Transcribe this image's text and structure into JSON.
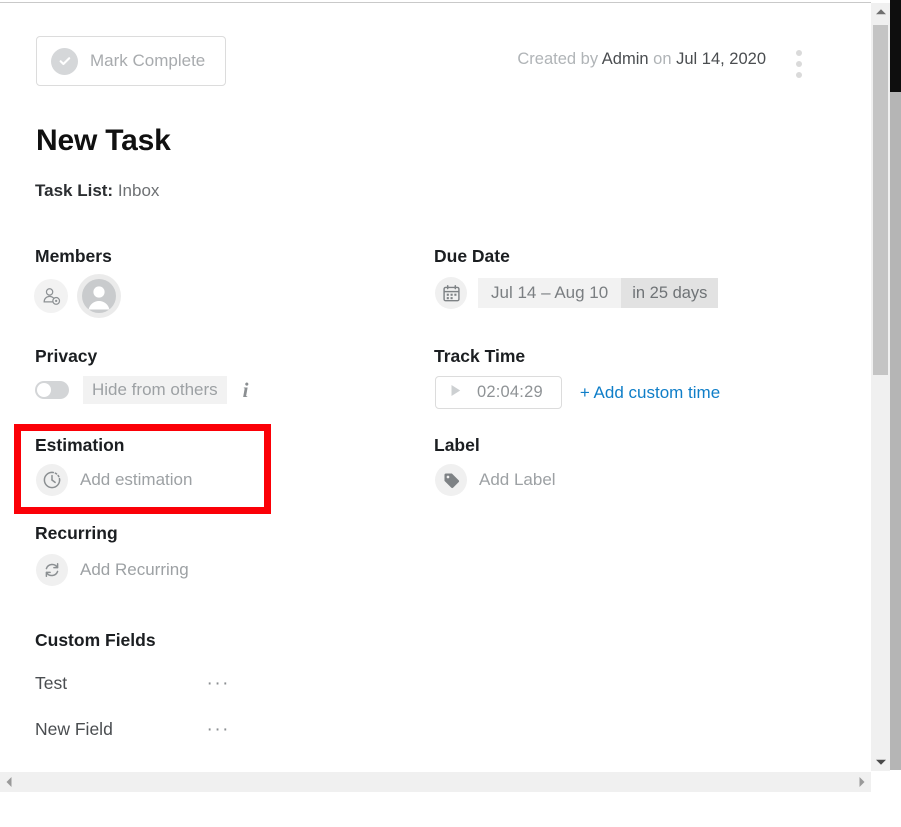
{
  "window": {
    "scroll_up_icon": "triangle-up-icon",
    "scroll_down_icon": "triangle-down-icon",
    "scroll_left_icon": "triangle-left-icon",
    "scroll_right_icon": "triangle-right-icon"
  },
  "header": {
    "mark_complete_label": "Mark Complete",
    "mark_complete_icon": "check-circle-icon",
    "created_prefix": "Created by",
    "created_author": "Admin",
    "created_on": "on",
    "created_date": "Jul 14, 2020",
    "kebab_icon": "more-vertical-icon"
  },
  "task": {
    "title": "New Task",
    "task_list_label": "Task List:",
    "task_list_value": "Inbox"
  },
  "sections": {
    "members": {
      "heading": "Members",
      "add_icon": "add-person-icon",
      "avatar_icon": "user-avatar-icon"
    },
    "due_date": {
      "heading": "Due Date",
      "icon": "calendar-icon",
      "range": "Jul 14 – Aug 10",
      "relative": "in 25 days"
    },
    "privacy": {
      "heading": "Privacy",
      "toggle_state": "off",
      "label": "Hide from others",
      "info_icon": "info-icon"
    },
    "track_time": {
      "heading": "Track Time",
      "play_icon": "play-icon",
      "timer": "02:04:29",
      "add_custom_label": "+ Add custom time",
      "link_color": "#0f7ec8"
    },
    "estimation": {
      "heading": "Estimation",
      "icon": "timer-clock-icon",
      "placeholder": "Add estimation",
      "highlight_color": "#fb0007"
    },
    "label": {
      "heading": "Label",
      "icon": "tag-icon",
      "placeholder": "Add Label"
    },
    "recurring": {
      "heading": "Recurring",
      "icon": "refresh-icon",
      "placeholder": "Add Recurring"
    },
    "custom_fields": {
      "heading": "Custom Fields",
      "rows": [
        {
          "name": "Test",
          "menu_icon": "more-horizontal-icon",
          "menu": "···"
        },
        {
          "name": "New Field",
          "menu_icon": "more-horizontal-icon",
          "menu": "···"
        }
      ]
    }
  }
}
